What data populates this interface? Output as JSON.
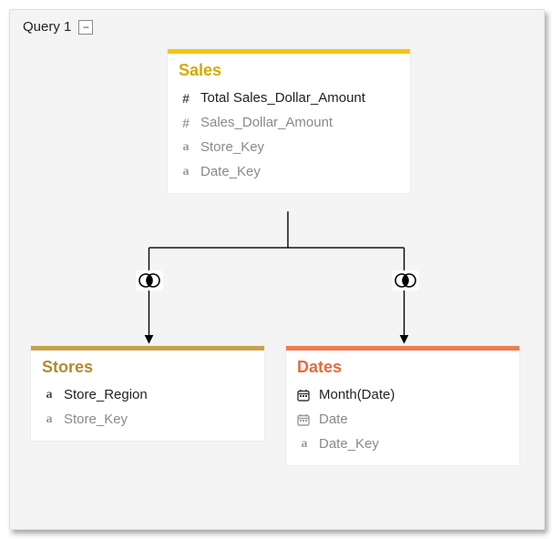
{
  "header": {
    "query_label": "Query 1",
    "collapse_glyph": "−"
  },
  "tables": {
    "sales": {
      "title": "Sales",
      "accent": "#f4c40f",
      "title_color": "#d6a900",
      "fields": [
        {
          "icon": "hash",
          "name": "Total Sales_Dollar_Amount",
          "active": true
        },
        {
          "icon": "hash",
          "name": "Sales_Dollar_Amount",
          "active": false
        },
        {
          "icon": "a",
          "name": "Store_Key",
          "active": false
        },
        {
          "icon": "a",
          "name": "Date_Key",
          "active": false
        }
      ]
    },
    "stores": {
      "title": "Stores",
      "accent": "#c7a24a",
      "title_color": "#b38a2f",
      "fields": [
        {
          "icon": "a",
          "name": "Store_Region",
          "active": true
        },
        {
          "icon": "a",
          "name": "Store_Key",
          "active": false
        }
      ]
    },
    "dates": {
      "title": "Dates",
      "accent": "#ef7b52",
      "title_color": "#e76b3f",
      "fields": [
        {
          "icon": "calendar",
          "name": "Month(Date)",
          "active": true
        },
        {
          "icon": "calendar",
          "name": "Date",
          "active": false
        },
        {
          "icon": "a",
          "name": "Date_Key",
          "active": false
        }
      ]
    }
  },
  "joins": [
    {
      "from": "sales",
      "to": "stores",
      "type": "inner"
    },
    {
      "from": "sales",
      "to": "dates",
      "type": "inner"
    }
  ]
}
